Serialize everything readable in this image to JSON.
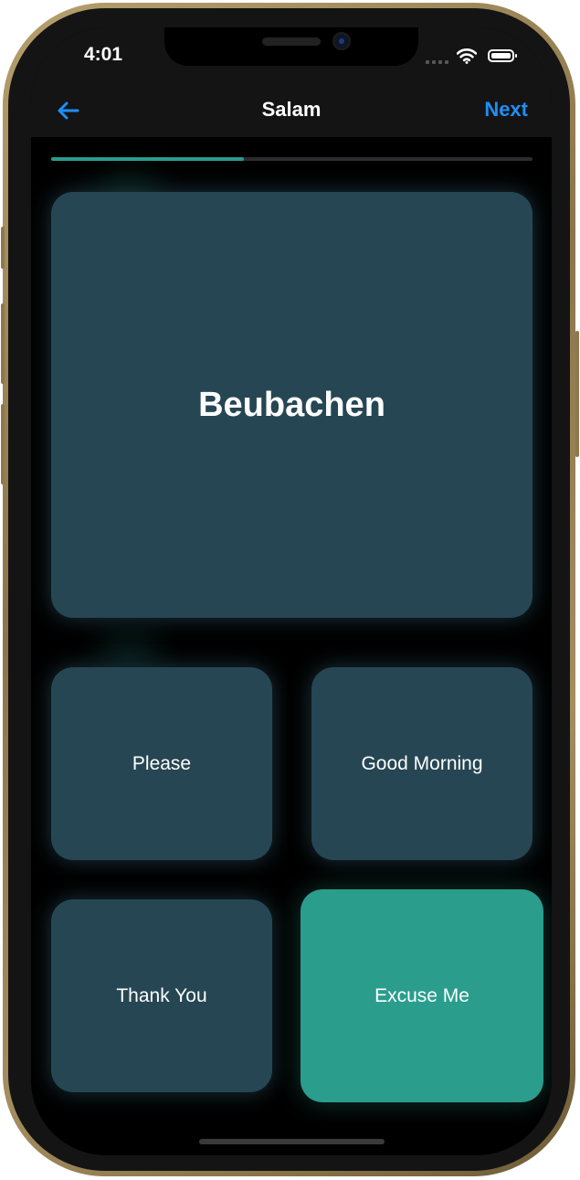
{
  "status_bar": {
    "time": "4:01"
  },
  "nav": {
    "back_icon": "arrow-left-icon",
    "title": "Salam",
    "next_label": "Next"
  },
  "progress": {
    "fraction": 0.4
  },
  "prompt": {
    "word": "Beubachen"
  },
  "options": [
    {
      "label": "Please",
      "selected": false
    },
    {
      "label": "Good Morning",
      "selected": false
    },
    {
      "label": "Thank You",
      "selected": false
    },
    {
      "label": "Excuse Me",
      "selected": true
    }
  ],
  "colors": {
    "accent": "#2a9d8d",
    "card": "#264653",
    "link": "#1f8ff5",
    "background": "#000000",
    "nav_bar": "#141414"
  }
}
